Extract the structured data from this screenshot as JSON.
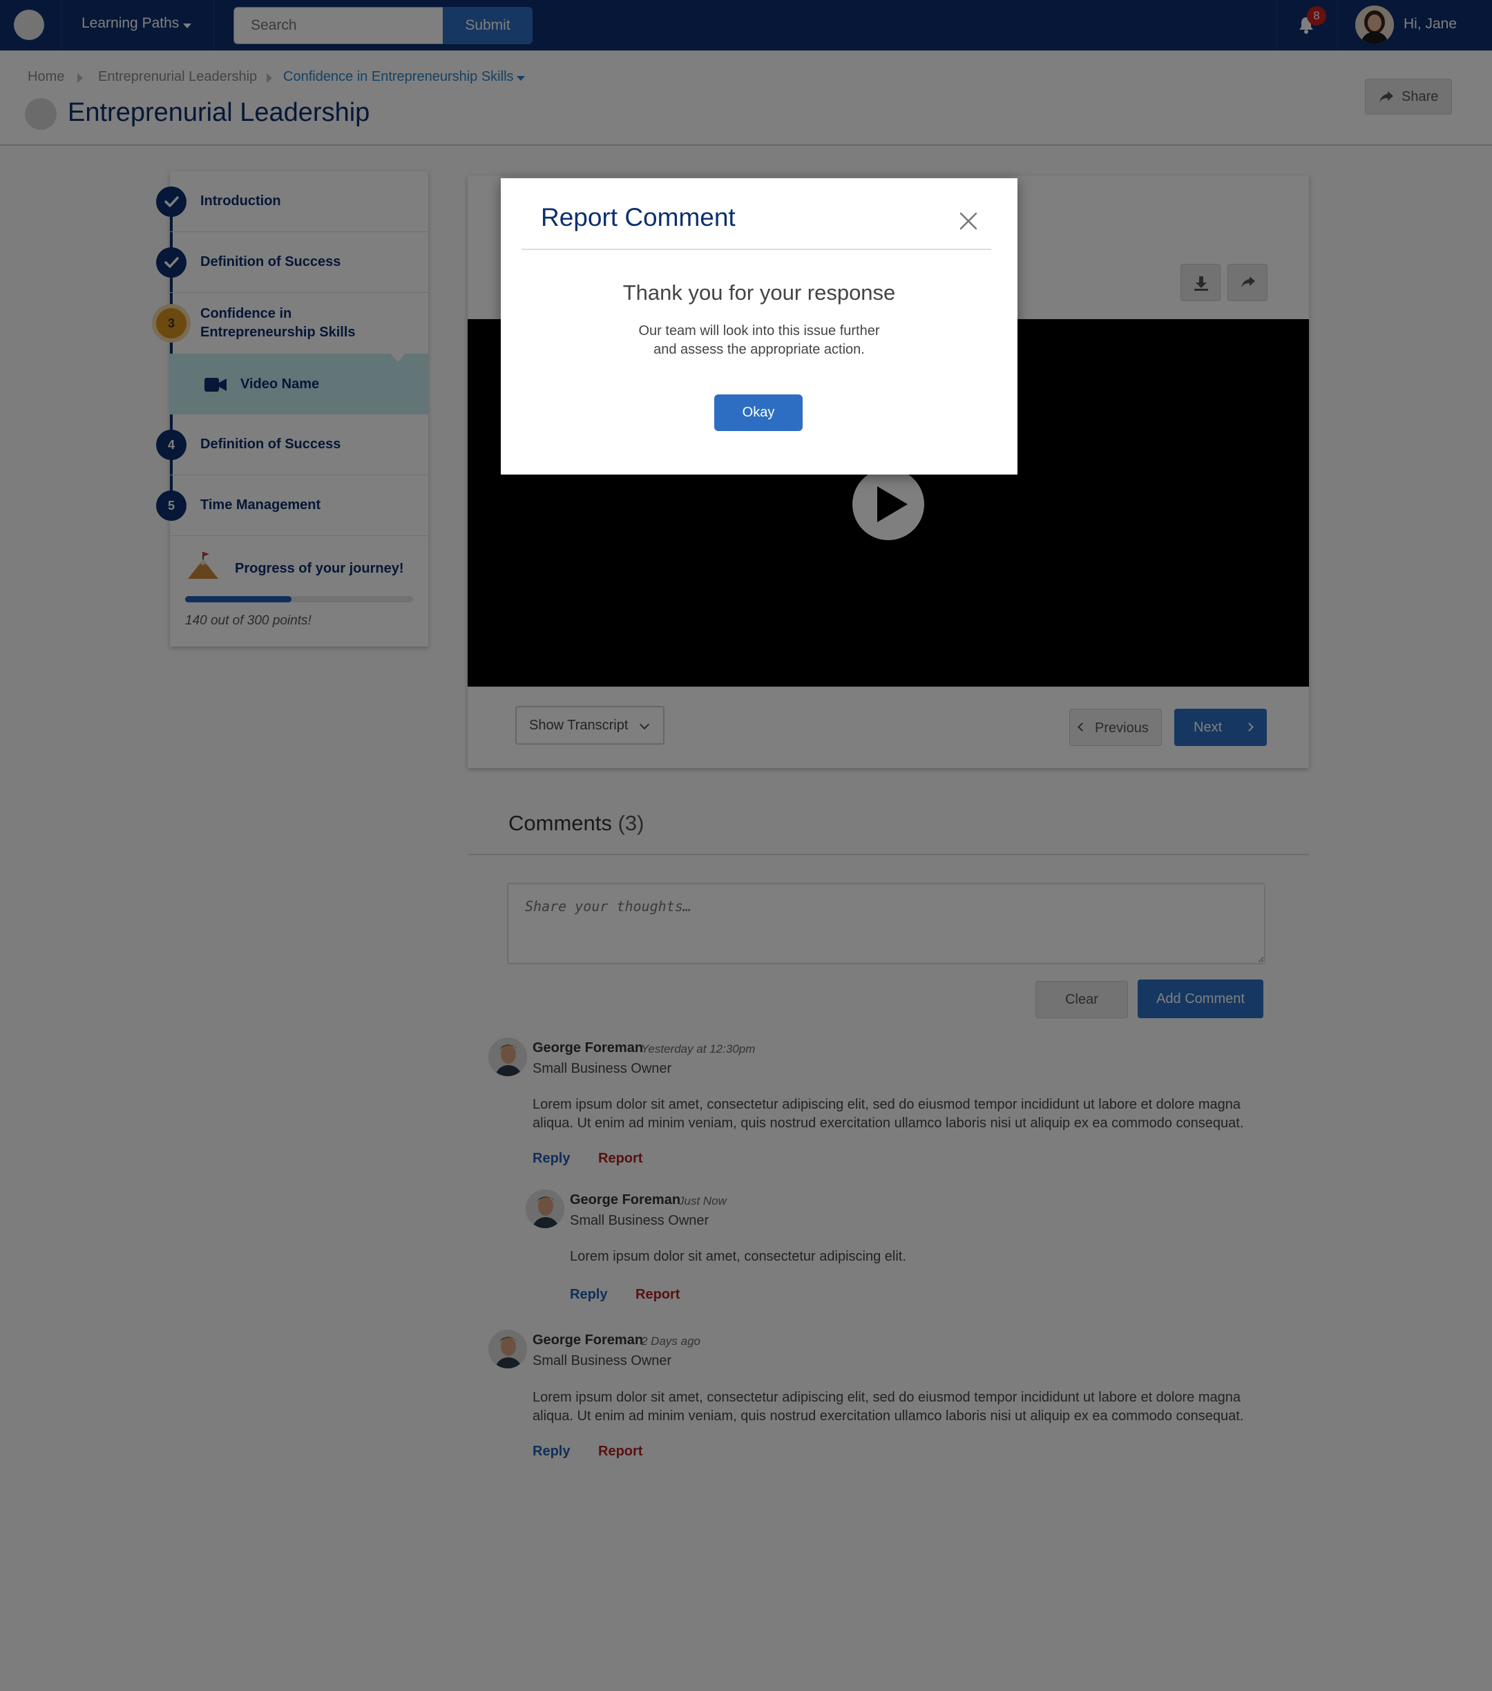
{
  "nav": {
    "menu_label": "Learning Paths",
    "search_placeholder": "Search",
    "submit_label": "Submit",
    "notification_count": "8",
    "greeting": "Hi, Jane"
  },
  "breadcrumb": [
    "Home",
    "Entreprenurial Leadership",
    "Confidence in Entrepreneurship Skills"
  ],
  "page": {
    "title": "Entreprenurial Leadership",
    "share_label": "Share"
  },
  "sidebar": {
    "steps": [
      {
        "marker": "check",
        "label": "Introduction",
        "status": "complete"
      },
      {
        "marker": "check",
        "label": "Definition of Success",
        "status": "complete"
      },
      {
        "marker": "3",
        "label": "Confidence in Entrepreneurship Skills",
        "status": "current"
      },
      {
        "marker": "4",
        "label": "Definition of Success",
        "status": "upcoming"
      },
      {
        "marker": "5",
        "label": "Time Management",
        "status": "upcoming"
      }
    ],
    "current_item": {
      "icon": "video-camera-icon",
      "label": "Video Name"
    },
    "progress": {
      "title": "Progress of your journey!",
      "text": "140 out of 300 points!",
      "points": 140,
      "total": 300
    }
  },
  "video": {
    "transcript_label": "Show Transcript",
    "previous_label": "Previous",
    "next_label": "Next"
  },
  "comments": {
    "title": "Comments",
    "count": "(3)",
    "placeholder": "Share your thoughts…",
    "clear_label": "Clear",
    "add_label": "Add Comment",
    "items": [
      {
        "name": "George Foreman",
        "time": "Yesterday at 12:30pm",
        "role": "Small Business Owner",
        "body": [
          "Lorem ipsum dolor sit amet, consectetur adipiscing elit, sed do eiusmod tempor incididunt ut labore et dolore magna",
          "aliqua. Ut enim ad minim veniam, quis nostrud exercitation ullamco laboris nisi ut aliquip ex ea commodo consequat."
        ],
        "reply": "Reply",
        "report": "Report"
      },
      {
        "name": "George Foreman",
        "time": "Just Now",
        "role": "Small Business Owner",
        "body": [
          "Lorem ipsum dolor sit amet, consectetur adipiscing elit."
        ],
        "reply": "Reply",
        "report": "Report"
      },
      {
        "name": "George Foreman",
        "time": "2 Days ago",
        "role": "Small Business Owner",
        "body": [
          "Lorem ipsum dolor sit amet, consectetur adipiscing elit, sed do eiusmod tempor incididunt ut labore et dolore magna",
          "aliqua. Ut enim ad minim veniam, quis nostrud exercitation ullamco laboris nisi ut aliquip ex ea commodo consequat."
        ],
        "reply": "Reply",
        "report": "Report"
      }
    ]
  },
  "modal": {
    "title": "Report Comment",
    "heading": "Thank you for your response",
    "body": [
      "Our team will look into this issue further",
      "and assess the appropriate action."
    ],
    "okay_label": "Okay"
  },
  "colors": {
    "navy": "#0c2f6e",
    "primary_blue": "#2d6ec2",
    "step_current": "#d8931f",
    "active_item_bg": "#c5ebef",
    "report_red": "#b02020",
    "badge_red": "#d01f1f"
  }
}
